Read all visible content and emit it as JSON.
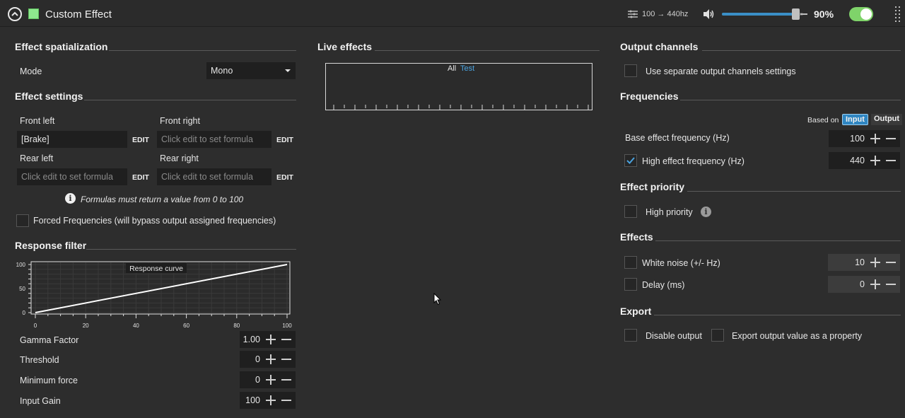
{
  "header": {
    "title": "Custom Effect",
    "swatch_color": "#8ee98e",
    "freq_range": "100 → 440hz",
    "volume_pct": "90%",
    "volume_level": 0.9,
    "enabled": true
  },
  "spatialization": {
    "title": "Effect spatialization",
    "mode_label": "Mode",
    "mode_value": "Mono"
  },
  "settings": {
    "title": "Effect settings",
    "front_left_label": "Front left",
    "front_left_value": "[Brake]",
    "front_right_label": "Front right",
    "front_right_placeholder": "Click edit to set formula",
    "rear_left_label": "Rear left",
    "rear_left_placeholder": "Click edit to set formula",
    "rear_right_label": "Rear right",
    "rear_right_placeholder": "Click edit to set formula",
    "edit_label": "EDIT",
    "note": "Formulas must return a value from 0 to 100",
    "forced_freq_label": "Forced Frequencies (will bypass output assigned frequencies)"
  },
  "response": {
    "title": "Response filter",
    "gamma_label": "Gamma Factor",
    "gamma_value": "1.00",
    "threshold_label": "Threshold",
    "threshold_value": "0",
    "min_force_label": "Minimum force",
    "min_force_value": "0",
    "input_gain_label": "Input Gain",
    "input_gain_value": "100"
  },
  "chart_data": {
    "type": "line",
    "title": "Response curve",
    "x": [
      0,
      100
    ],
    "series": [
      {
        "values": [
          0,
          100
        ]
      }
    ],
    "xlim": [
      0,
      100
    ],
    "ylim": [
      0,
      100
    ],
    "x_ticks": [
      "0",
      "20",
      "40",
      "60",
      "80",
      "100"
    ],
    "y_ticks": [
      "100",
      "50",
      "0"
    ],
    "grid": true
  },
  "live": {
    "title": "Live effects",
    "tab_all": "All",
    "tab_test": "Test",
    "accent": "#4aa3e0"
  },
  "output_channels": {
    "title": "Output channels",
    "separate_label": "Use separate output channels settings"
  },
  "frequencies": {
    "title": "Frequencies",
    "based_on_label": "Based on",
    "input_label": "Input",
    "output_label": "Output",
    "base_label": "Base effect frequency (Hz)",
    "base_value": "100",
    "high_label": "High effect frequency (Hz)",
    "high_value": "440"
  },
  "priority": {
    "title": "Effect priority",
    "high_label": "High priority"
  },
  "effects": {
    "title": "Effects",
    "white_noise_label": "White noise (+/- Hz)",
    "white_noise_value": "10",
    "delay_label": "Delay (ms)",
    "delay_value": "0"
  },
  "export": {
    "title": "Export",
    "disable_label": "Disable output",
    "property_label": "Export output value as a property"
  }
}
